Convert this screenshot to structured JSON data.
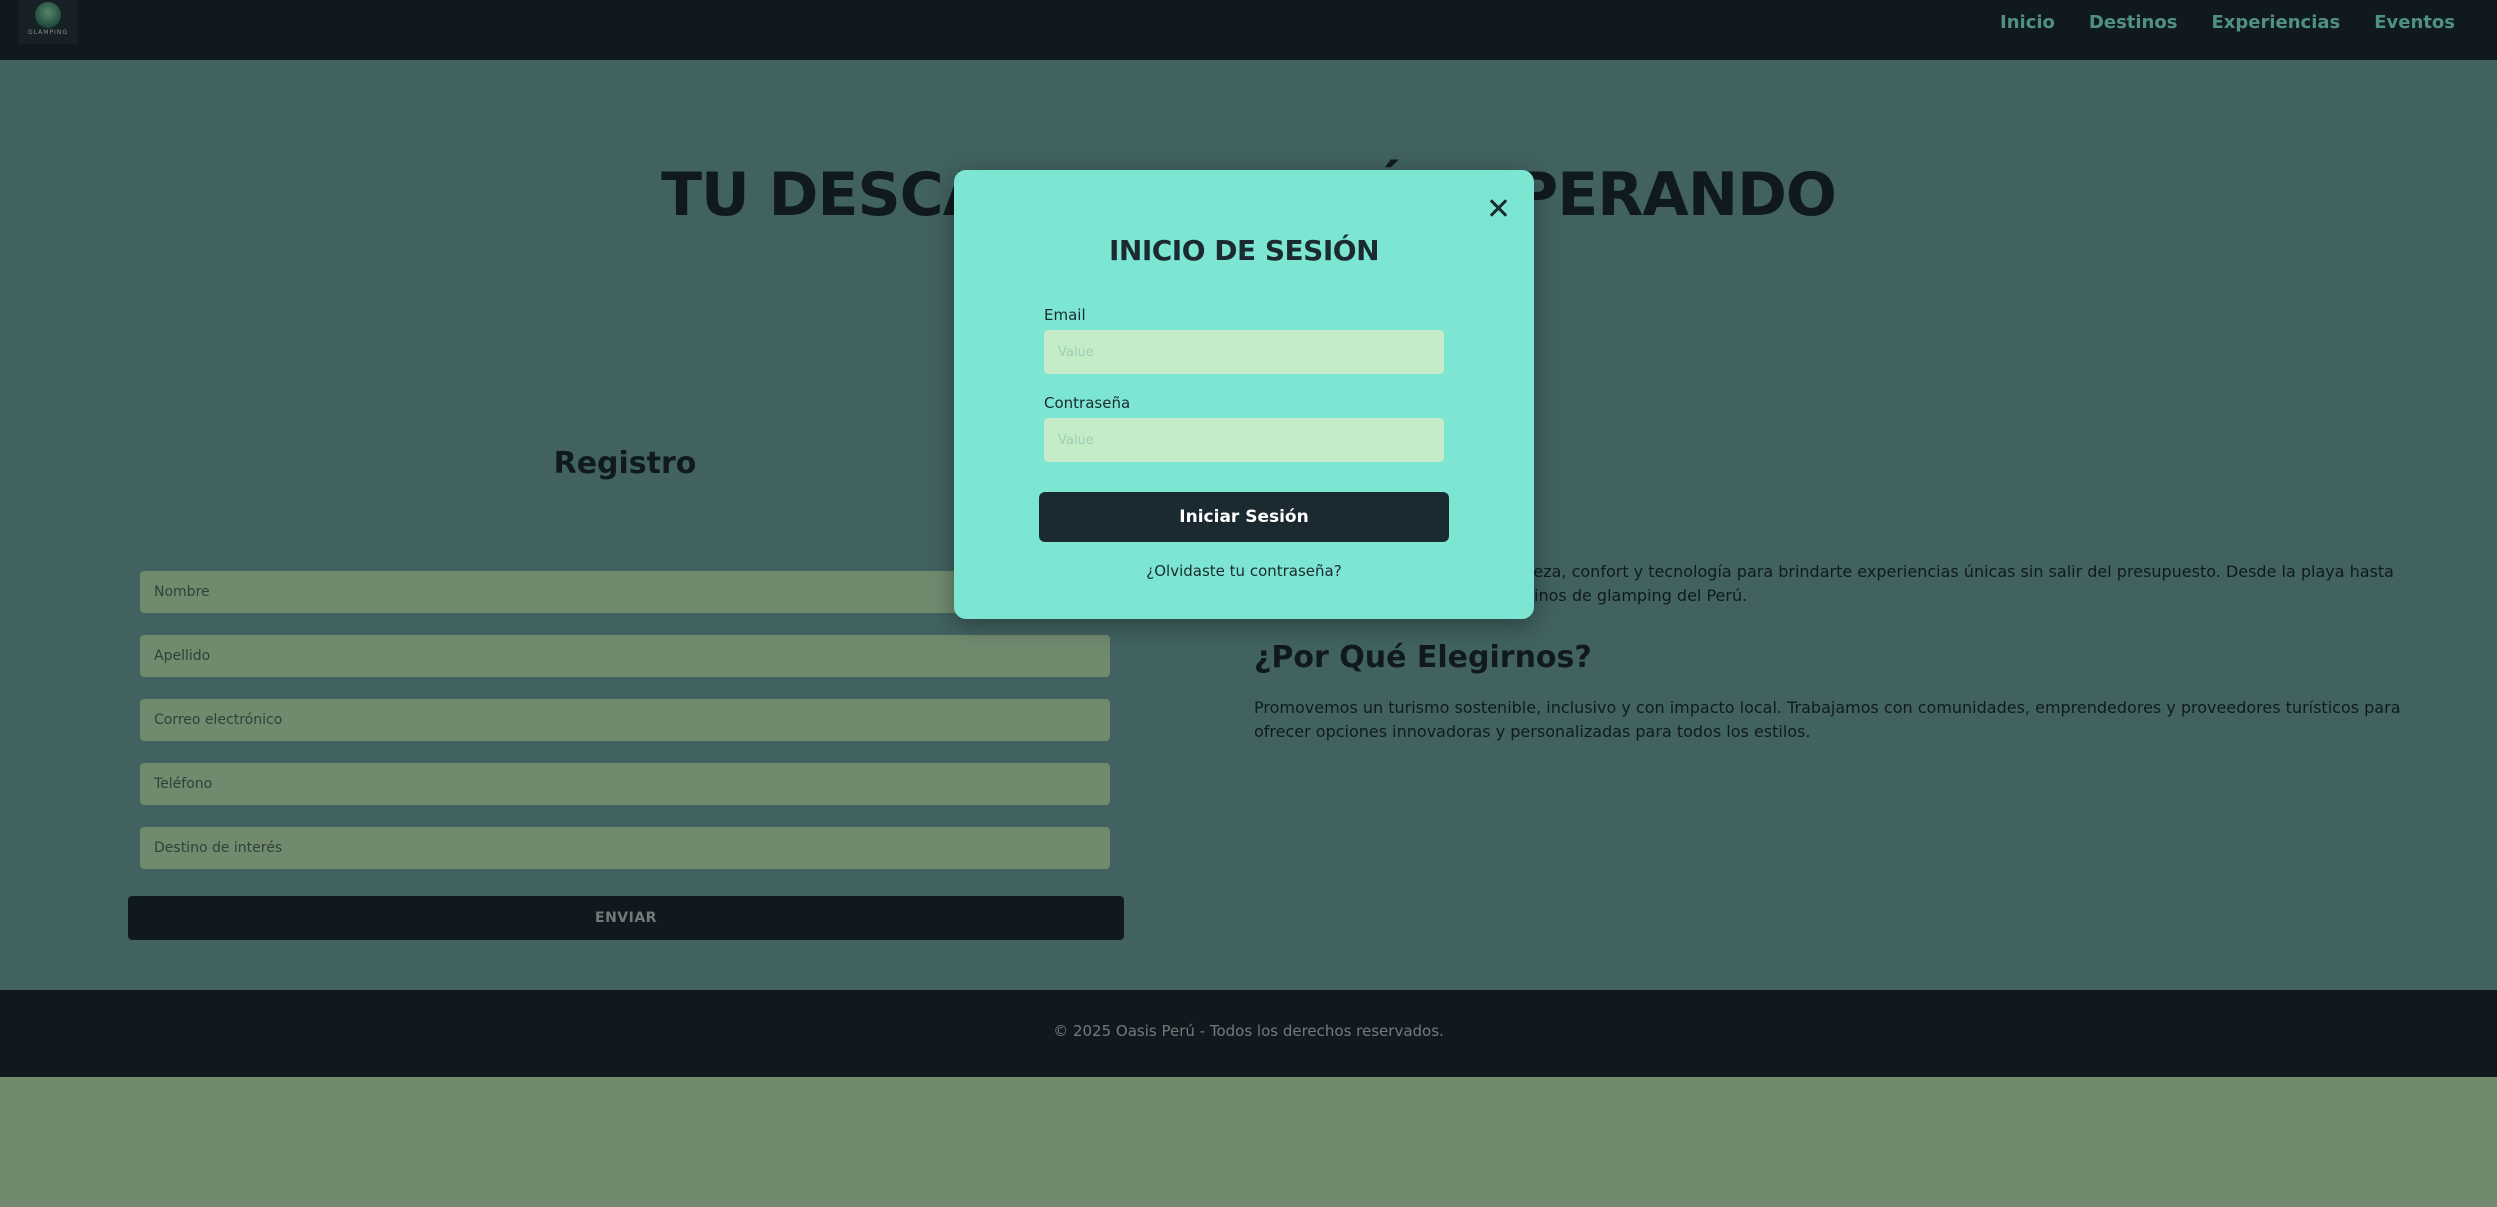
{
  "nav": {
    "logo_text": "GLAMPING",
    "links": [
      "Inicio",
      "Destinos",
      "Experiencias",
      "Eventos"
    ]
  },
  "hero": {
    "title": "TU DESCANSO TE ESTÁ ESPERANDO"
  },
  "registration": {
    "title": "Registro",
    "fields": [
      "Nombre",
      "Apellido",
      "Correo electrónico",
      "Teléfono",
      "Destino de interés"
    ],
    "submit_label": "ENVIAR"
  },
  "about": {
    "text": "En Oasis Perú combinamos naturaleza, confort y tecnología para brindarte experiencias únicas sin salir del presupuesto. Desde la playa hasta la selva, accede a los mejores destinos de glamping del Perú."
  },
  "why": {
    "title": "¿Por Qué Elegirnos?",
    "text": "Promovemos un turismo sostenible, inclusivo y con impacto local. Trabajamos con comunidades, emprendedores y proveedores turísticos para ofrecer opciones innovadoras y personalizadas para todos los estilos."
  },
  "footer": {
    "text": "© 2025 Oasis Perú - Todos los derechos reservados."
  },
  "modal": {
    "title": "INICIO DE SESIÓN",
    "email_label": "Email",
    "email_placeholder": "Value",
    "password_label": "Contraseña",
    "password_placeholder": "Value",
    "login_label": "Iniciar Sesión",
    "forgot_label": "¿Olvidaste tu contraseña?"
  }
}
